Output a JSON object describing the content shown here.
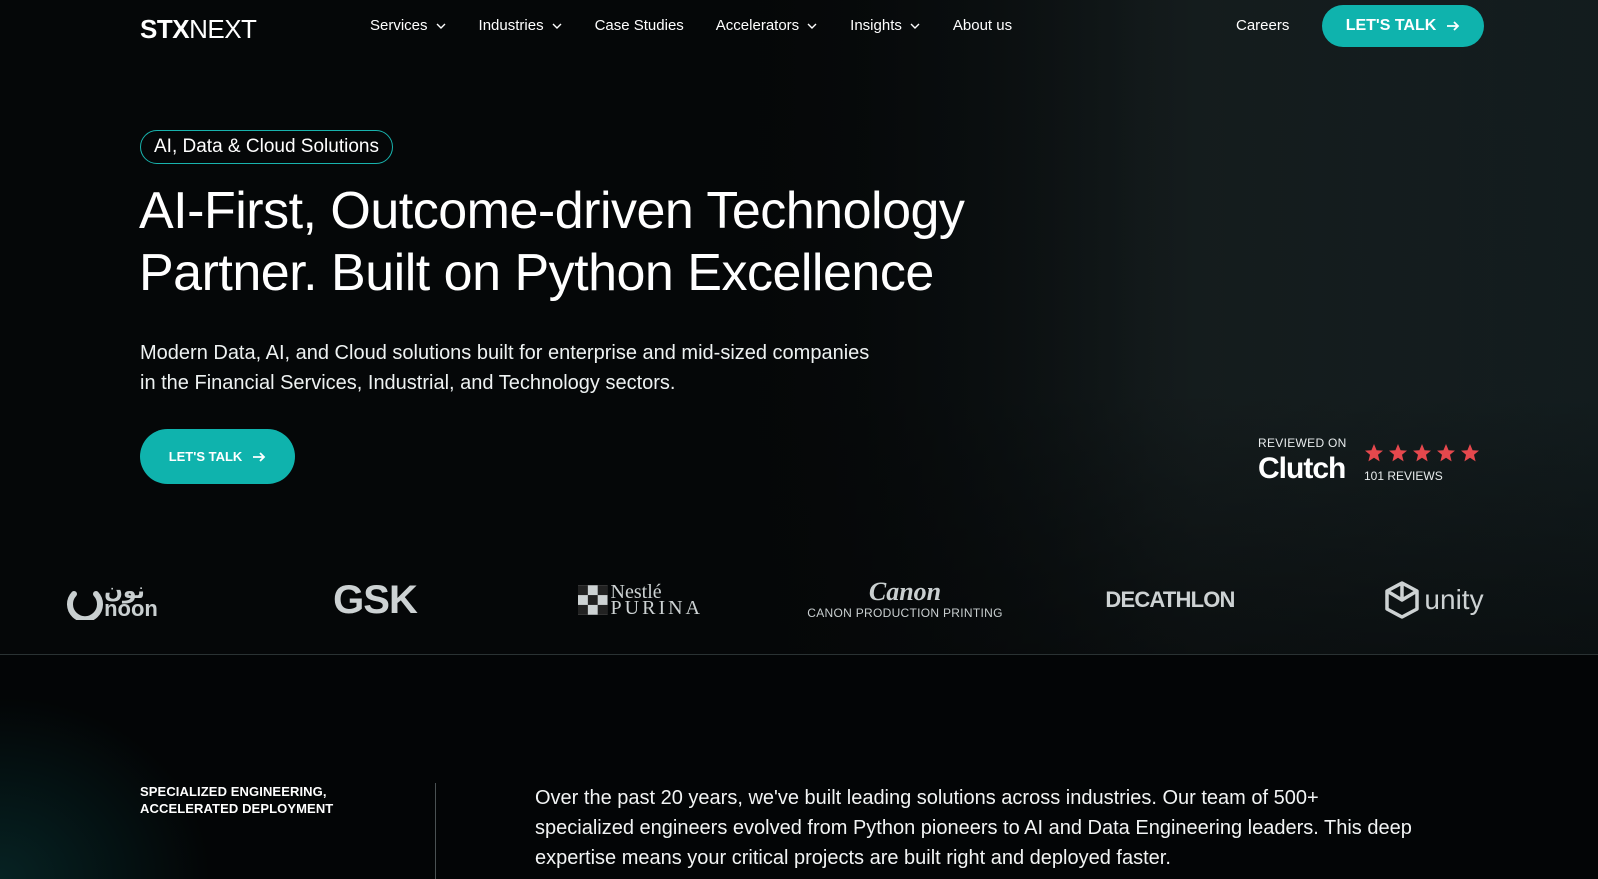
{
  "nav": {
    "logo_bold": "STX",
    "logo_thin": "NEXT",
    "items": [
      {
        "label": "Services",
        "has_dropdown": true
      },
      {
        "label": "Industries",
        "has_dropdown": true
      },
      {
        "label": "Case Studies",
        "has_dropdown": false
      },
      {
        "label": "Accelerators",
        "has_dropdown": true
      },
      {
        "label": "Insights",
        "has_dropdown": true
      },
      {
        "label": "About us",
        "has_dropdown": false
      }
    ],
    "careers": "Careers",
    "cta": "LET'S TALK"
  },
  "hero": {
    "pill": "AI, Data & Cloud Solutions",
    "headline_line1": "AI-First, Outcome-driven Technology",
    "headline_line2": "Partner. Built on Python Excellence",
    "subhead_line1": "Modern Data, AI, and Cloud solutions built for enterprise and mid-sized companies",
    "subhead_line2": "in the Financial Services, Industrial, and Technology sectors.",
    "cta": "LET'S TALK"
  },
  "clutch": {
    "reviewed_on": "REVIEWED ON",
    "brand": "Clutch",
    "rating": 5,
    "reviews": "101 REVIEWS",
    "star_color": "#e5484d"
  },
  "logos": {
    "noon_arabic": "نون",
    "noon": "noon",
    "gsk": "GSK",
    "nestle": "Nestlé",
    "purina": "PURINA",
    "canon": "Canon",
    "canon_sub": "CANON PRODUCTION PRINTING",
    "decathlon": "DECATHLON",
    "unity": "unity"
  },
  "about": {
    "label_line1": "SPECIALIZED ENGINEERING,",
    "label_line2": "ACCELERATED DEPLOYMENT",
    "body_line1": "Over the past 20 years, we've built leading solutions across industries. Our team of 500+",
    "body_line2": "specialized engineers evolved from Python pioneers to AI and Data Engineering leaders. This deep",
    "body_line3": "expertise means your critical projects are built right and deployed faster."
  },
  "colors": {
    "accent": "#0fb3ad",
    "background": "#050708"
  }
}
